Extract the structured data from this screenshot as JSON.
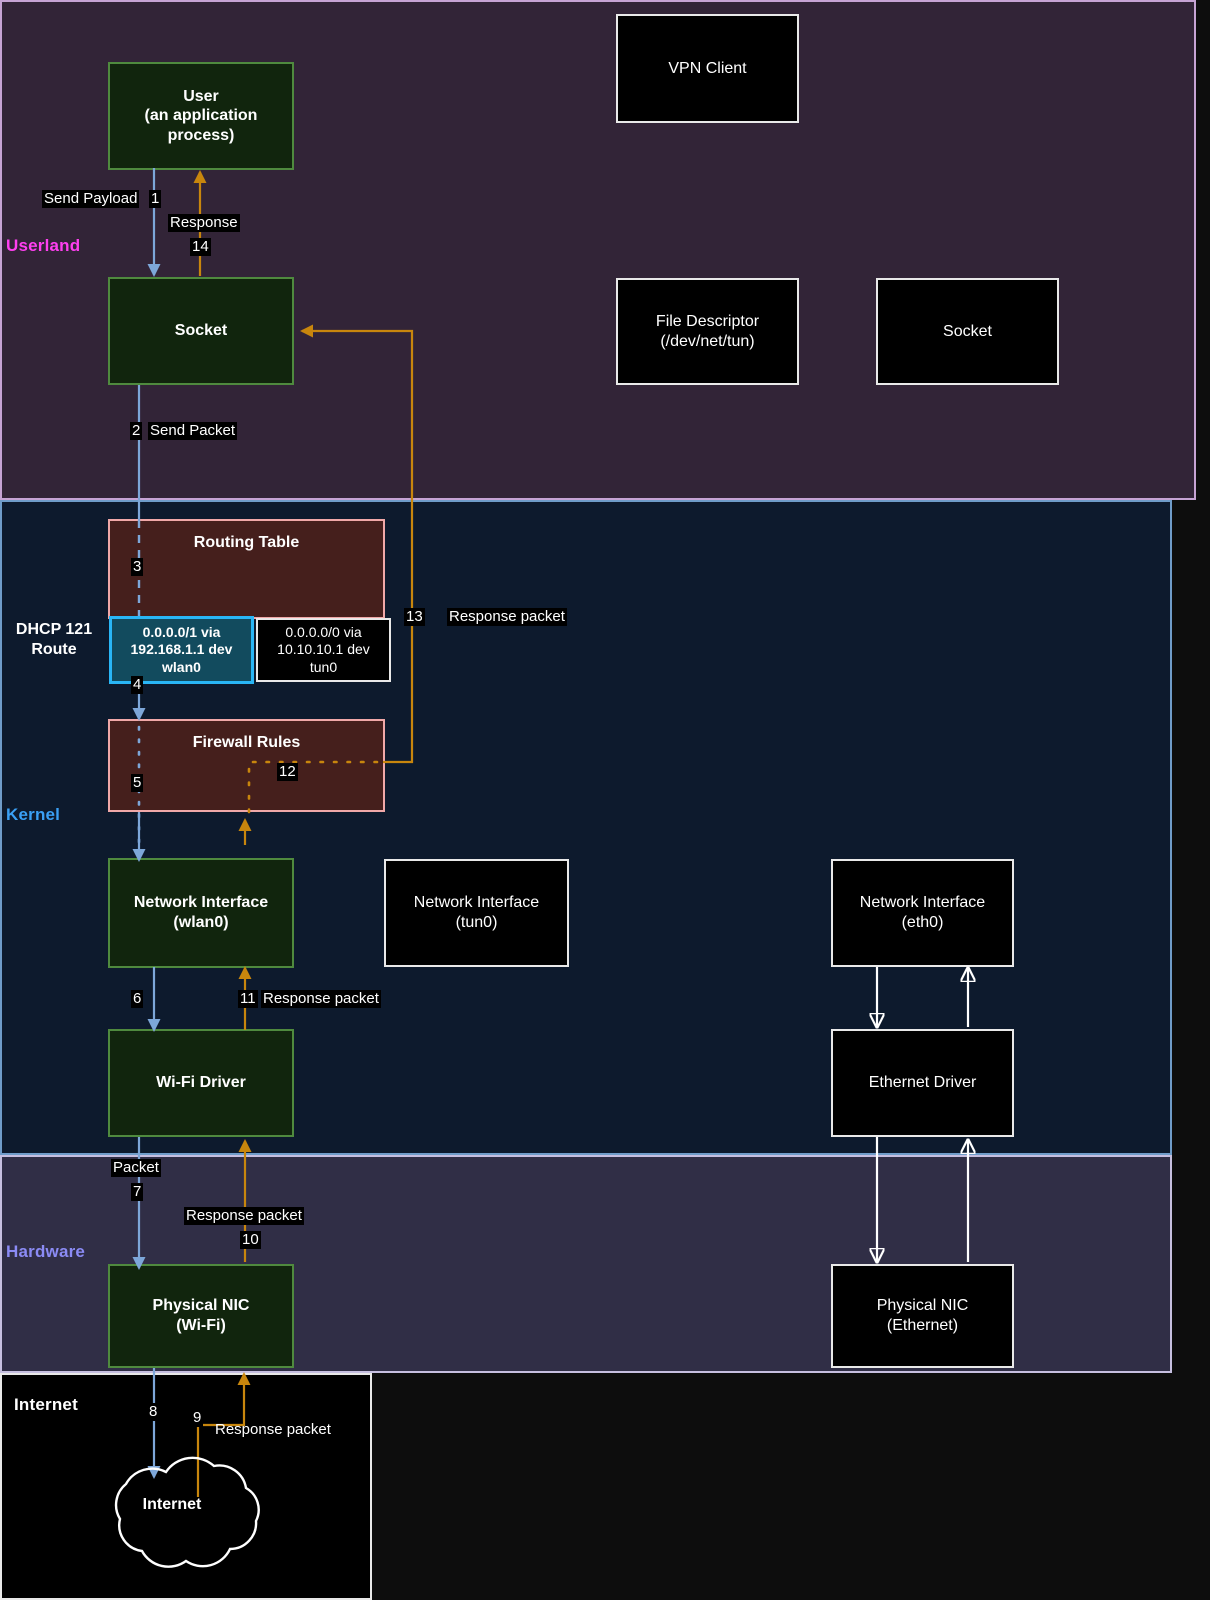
{
  "layers": [
    {
      "id": "userland",
      "label": "Userland"
    },
    {
      "id": "kernel",
      "label": "Kernel"
    },
    {
      "id": "hardware",
      "label": "Hardware"
    },
    {
      "id": "internet",
      "label": "Internet"
    }
  ],
  "nodes": {
    "user_process": {
      "line1": "User",
      "line2": "(an application",
      "line3": "process)"
    },
    "socket_user": {
      "label": "Socket"
    },
    "vpn_client": {
      "label": "VPN Client"
    },
    "file_descriptor": {
      "line1": "File Descriptor",
      "line2": "(/dev/net/tun)"
    },
    "socket_vpn": {
      "label": "Socket"
    },
    "routing_table": {
      "label": "Routing Table"
    },
    "firewall_rules": {
      "label": "Firewall Rules"
    },
    "dhcp_note": {
      "line1": "DHCP 121",
      "line2": "Route"
    },
    "route_wlan0": {
      "line1": "0.0.0.0/1 via",
      "line2": "192.168.1.1 dev",
      "line3": "wlan0"
    },
    "route_tun0": {
      "line1": "0.0.0.0/0 via",
      "line2": "10.10.10.1 dev",
      "line3": "tun0"
    },
    "netif_wlan0": {
      "line1": "Network Interface",
      "line2": "(wlan0)"
    },
    "netif_tun0": {
      "line1": "Network Interface",
      "line2": "(tun0)"
    },
    "netif_eth0": {
      "line1": "Network Interface",
      "line2": "(eth0)"
    },
    "wifi_driver": {
      "label": "Wi-Fi Driver"
    },
    "ethernet_driver": {
      "label": "Ethernet Driver"
    },
    "nic_wifi": {
      "line1": "Physical NIC",
      "line2": "(Wi-Fi)"
    },
    "nic_ethernet": {
      "line1": "Physical NIC",
      "line2": "(Ethernet)"
    },
    "internet_cloud": {
      "label": "Internet"
    }
  },
  "edges": [
    {
      "step": "1",
      "label": "Send Payload",
      "from": "user_process",
      "to": "socket_user",
      "direction": "down"
    },
    {
      "step": "2",
      "label": "Send Packet",
      "from": "socket_user",
      "to": "routing_table",
      "direction": "down"
    },
    {
      "step": "3",
      "label": "",
      "from": "routing_table",
      "to": "route_wlan0",
      "direction": "down"
    },
    {
      "step": "4",
      "label": "",
      "from": "route_wlan0",
      "to": "firewall_rules",
      "direction": "down"
    },
    {
      "step": "5",
      "label": "",
      "from": "firewall_rules",
      "to": "netif_wlan0",
      "direction": "down"
    },
    {
      "step": "6",
      "label": "",
      "from": "netif_wlan0",
      "to": "wifi_driver",
      "direction": "down"
    },
    {
      "step": "7",
      "label": "Packet",
      "from": "wifi_driver",
      "to": "nic_wifi",
      "direction": "down"
    },
    {
      "step": "8",
      "label": "",
      "from": "nic_wifi",
      "to": "internet_cloud",
      "direction": "down"
    },
    {
      "step": "9",
      "label": "Response packet",
      "from": "internet_cloud",
      "to": "nic_wifi",
      "direction": "up"
    },
    {
      "step": "10",
      "label": "Response packet",
      "from": "nic_wifi",
      "to": "wifi_driver",
      "direction": "up"
    },
    {
      "step": "11",
      "label": "Response packet",
      "from": "wifi_driver",
      "to": "netif_wlan0",
      "direction": "up"
    },
    {
      "step": "12",
      "label": "",
      "from": "netif_wlan0",
      "to": "firewall_rules",
      "direction": "up"
    },
    {
      "step": "13",
      "label": "Response packet",
      "from": "firewall_rules",
      "to": "socket_user",
      "direction": "up"
    },
    {
      "step": "14",
      "label": "Response",
      "from": "socket_user",
      "to": "user_process",
      "direction": "up"
    }
  ],
  "chips": {
    "send_payload": "Send Payload",
    "n1": "1",
    "response": "Response",
    "n14": "14",
    "n2": "2",
    "send_packet": "Send Packet",
    "n3": "3",
    "n4": "4",
    "n5": "5",
    "n12": "12",
    "n13": "13",
    "resp_pkt_13": "Response packet",
    "n6": "6",
    "n11": "11",
    "resp_pkt_11": "Response packet",
    "packet": "Packet",
    "n7": "7",
    "resp_pkt_10": "Response packet",
    "n10": "10",
    "n8": "8",
    "n9": "9",
    "resp_pkt_9": "Response packet"
  },
  "colors": {
    "userland_bg": "#322437",
    "userland_border": "#c6a3d4",
    "kernel_bg": "#0d1a2d",
    "kernel_border": "#6f9cc9",
    "hardware_bg": "#302e46",
    "hardware_border": "#c6bfe0",
    "internet_bg": "#000000",
    "node_green_bg": "#11250d",
    "node_green_border": "#4f8a3e",
    "node_red_bg": "#451f1c",
    "node_red_border": "#f0a8a8",
    "route_highlight_bg": "#124b5e",
    "route_highlight_border": "#29b6f6",
    "flow_forward": "#7da7d9",
    "flow_response": "#c8860d",
    "userland_label": "#ff3ff0",
    "kernel_label": "#3aa0f5",
    "hardware_label": "#8b8bf5"
  }
}
